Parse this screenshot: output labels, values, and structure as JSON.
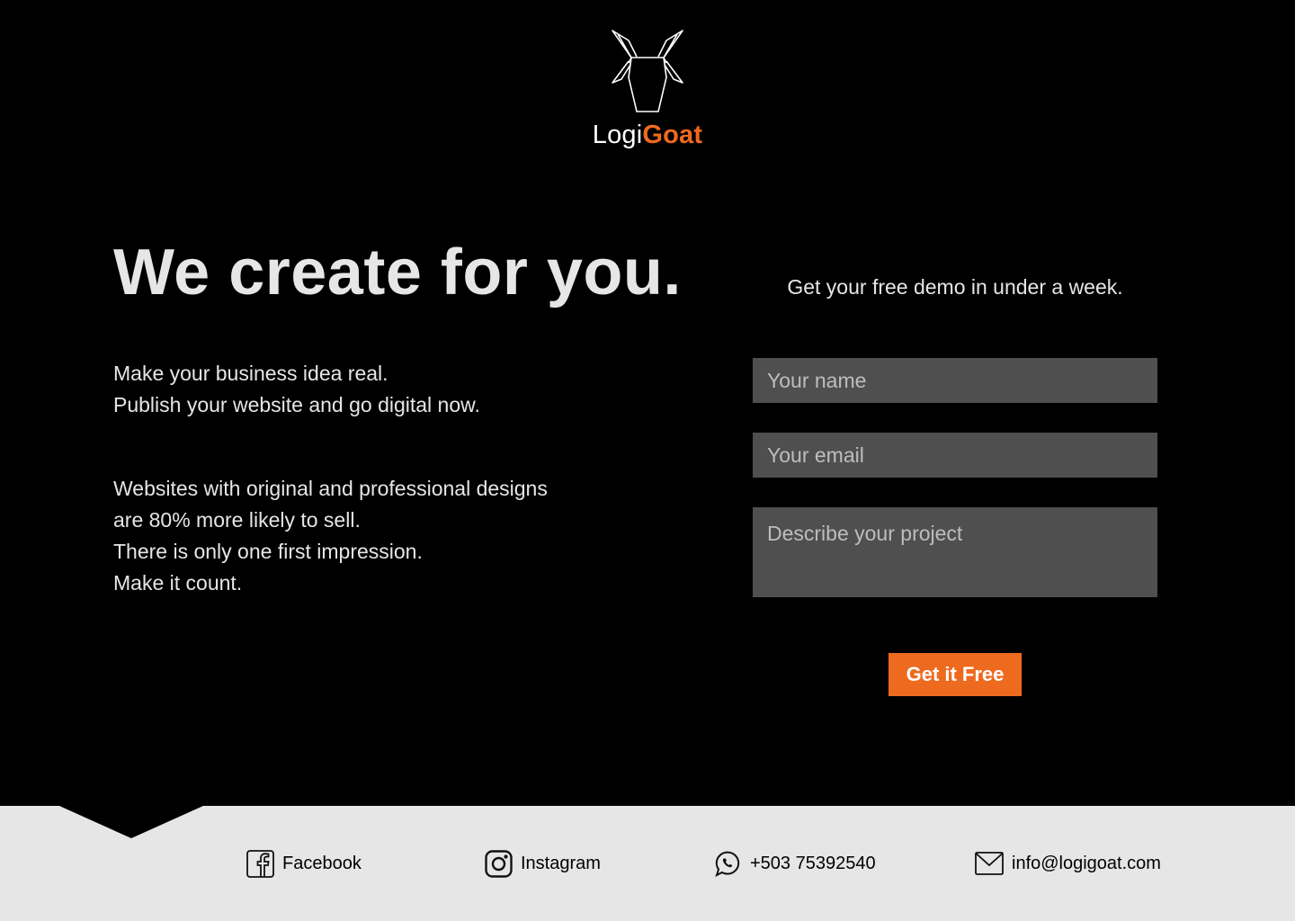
{
  "brand": {
    "name_part1": "Logi",
    "name_part2": "Goat",
    "accent_color": "#ee6a1f"
  },
  "hero": {
    "headline": "We create for you.",
    "intro_lines": [
      "Make your business idea real.",
      "Publish your website and go digital now."
    ],
    "body_lines": [
      "Websites with original and professional designs",
      "are 80% more likely to sell.",
      "There is only one first impression.",
      "Make it count."
    ]
  },
  "form": {
    "title": "Get your free demo in under a week.",
    "name_placeholder": "Your name",
    "email_placeholder": "Your email",
    "project_placeholder": "Describe your project",
    "submit_label": "Get it Free"
  },
  "footer": {
    "links": [
      {
        "label": "Facebook",
        "icon": "facebook-icon"
      },
      {
        "label": "Instagram",
        "icon": "instagram-icon"
      },
      {
        "label": "+503 75392540",
        "icon": "whatsapp-icon"
      },
      {
        "label": "info@logigoat.com",
        "icon": "mail-icon"
      }
    ]
  },
  "colors": {
    "background": "#000000",
    "text": "#e6e6e6",
    "field_bg": "#4f4f4f",
    "footer_bg": "#e6e6e6"
  }
}
